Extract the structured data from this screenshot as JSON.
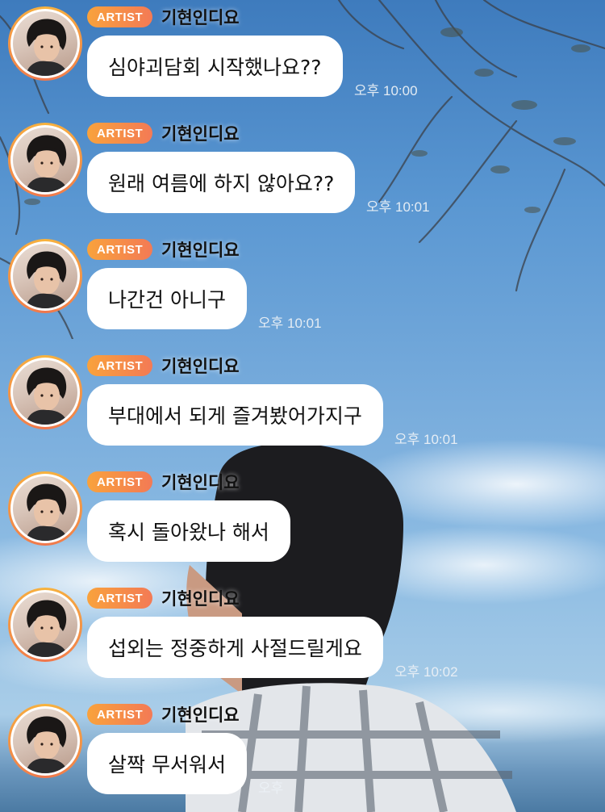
{
  "colors": {
    "badge_start": "#f9a23c",
    "badge_end": "#f37a55",
    "bubble_bg": "#ffffff",
    "sky": "#5a97d2"
  },
  "messages": [
    {
      "badge": "ARTIST",
      "name": "기현인디요",
      "text": "심야괴담회 시작했나요??",
      "time": "오후 10:00",
      "avatar_icon": "profile-photo"
    },
    {
      "badge": "ARTIST",
      "name": "기현인디요",
      "text": "원래 여름에 하지 않아요??",
      "time": "오후 10:01",
      "avatar_icon": "profile-photo"
    },
    {
      "badge": "ARTIST",
      "name": "기현인디요",
      "text": "나간건 아니구",
      "time": "오후 10:01",
      "avatar_icon": "profile-photo"
    },
    {
      "badge": "ARTIST",
      "name": "기현인디요",
      "text": "부대에서 되게 즐겨봤어가지구",
      "time": "오후 10:01",
      "avatar_icon": "profile-photo"
    },
    {
      "badge": "ARTIST",
      "name": "기현인디요",
      "text": "혹시 돌아왔나 해서",
      "time": "",
      "avatar_icon": "profile-photo"
    },
    {
      "badge": "ARTIST",
      "name": "기현인디요",
      "text": "섭외는 정중하게 사절드릴게요",
      "time": "오후 10:02",
      "avatar_icon": "profile-photo"
    },
    {
      "badge": "ARTIST",
      "name": "기현인디요",
      "text": "살짝 무서워서",
      "time": "오후",
      "avatar_icon": "profile-photo"
    }
  ]
}
